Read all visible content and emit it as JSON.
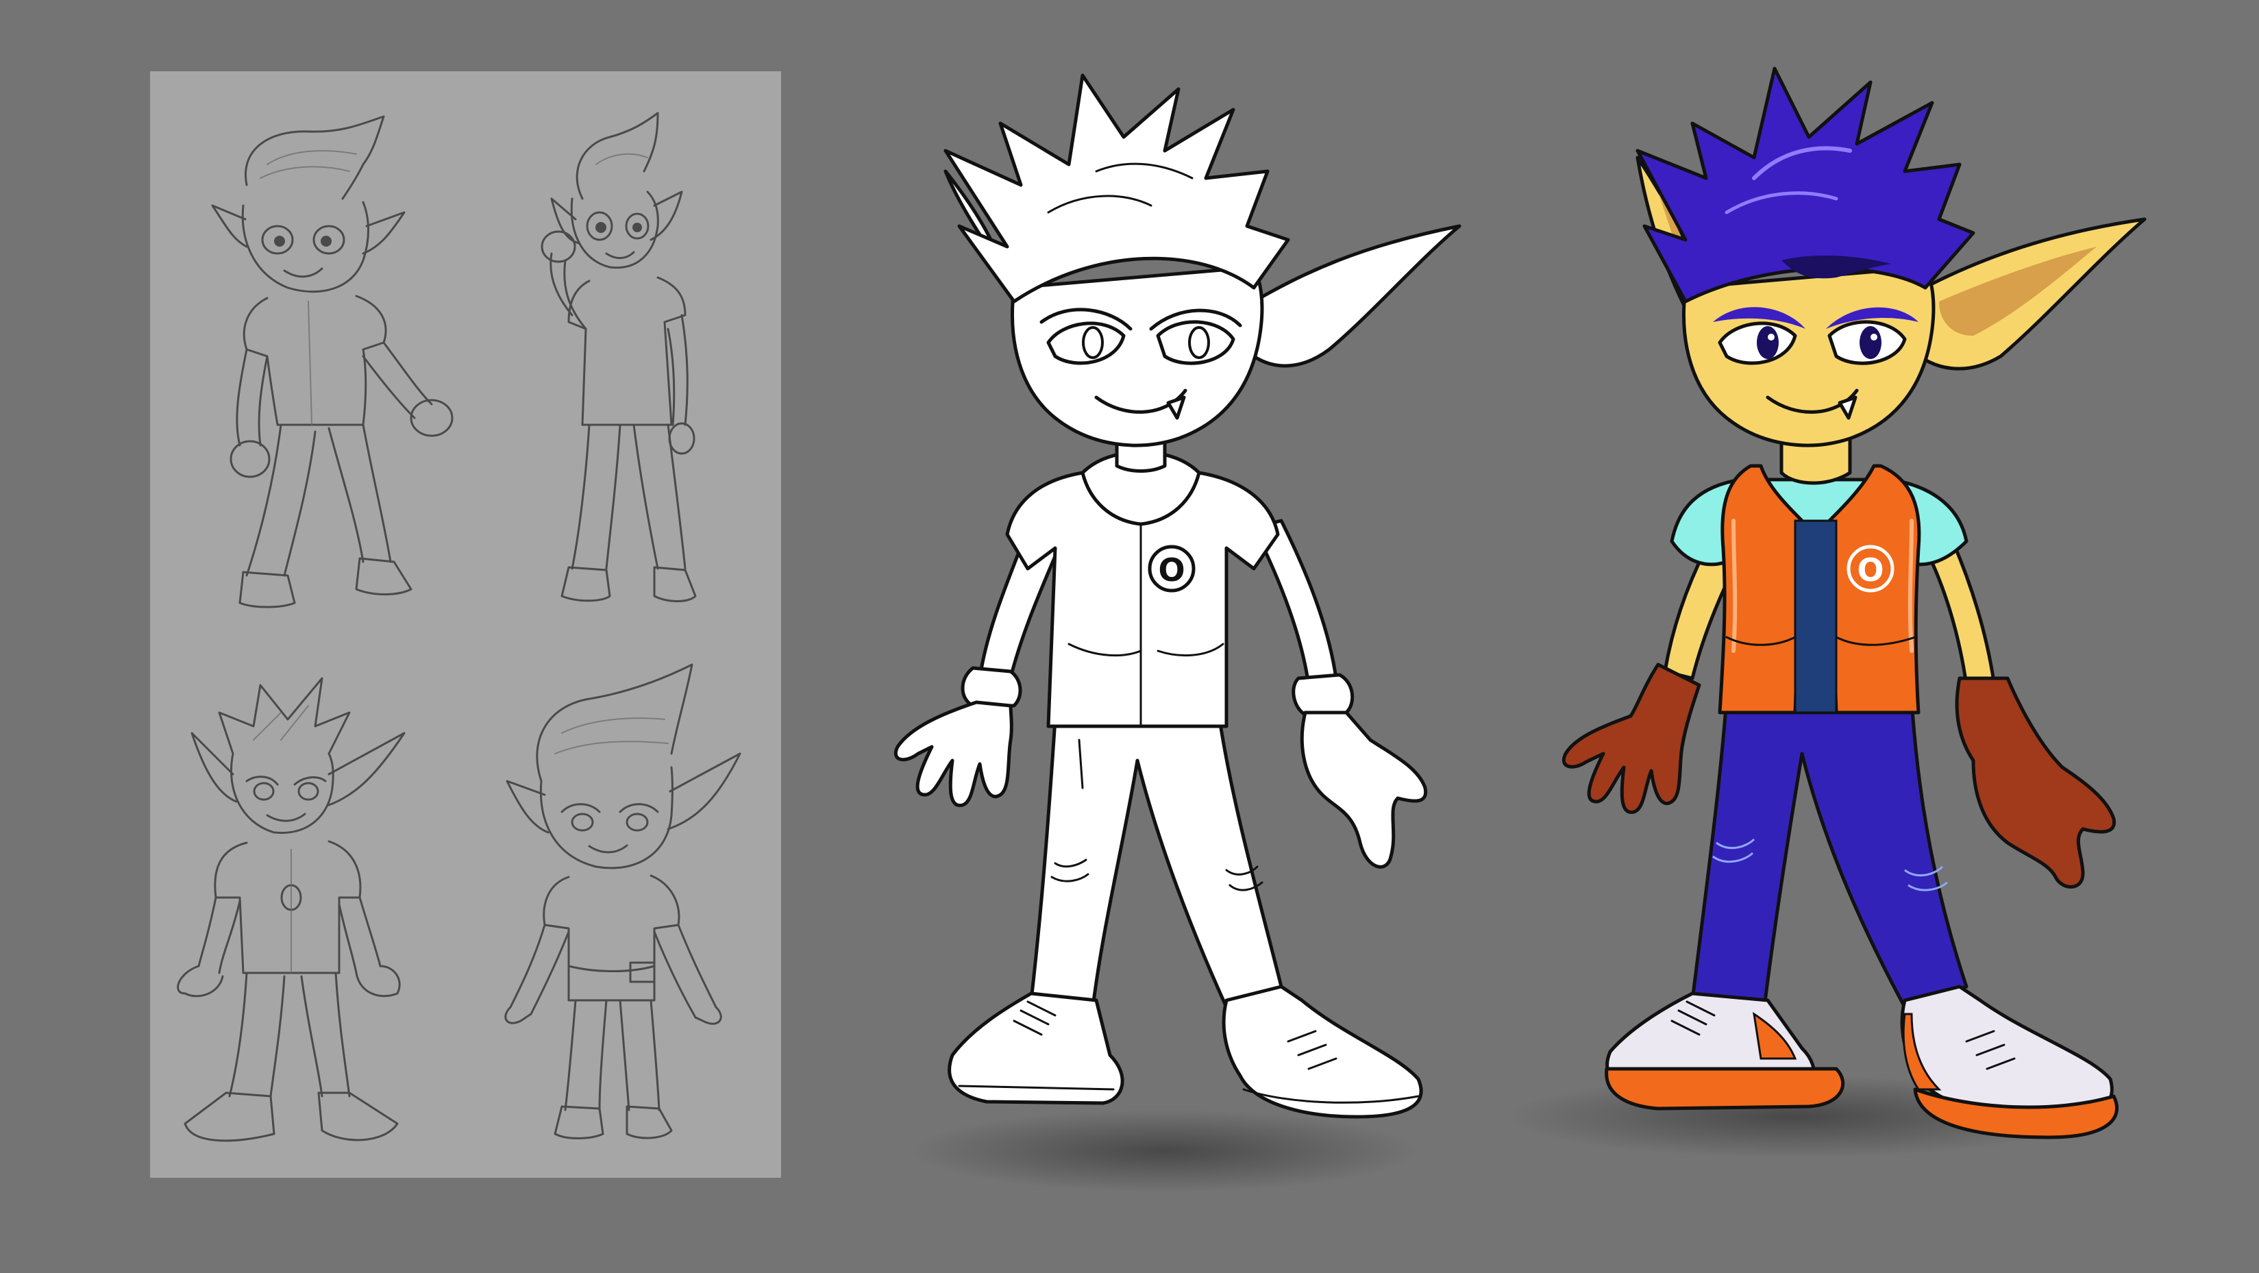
{
  "canvas": {
    "background_color": "#747474"
  },
  "sketch_panel": {
    "background_color": "#a6a6a6",
    "line_color": "#4a4a4a",
    "sketches": [
      {
        "pose": "standing-fists",
        "position": "top-left"
      },
      {
        "pose": "raised-fist",
        "position": "top-right"
      },
      {
        "pose": "jacket-standing",
        "position": "bottom-left"
      },
      {
        "pose": "chibi-standing",
        "position": "bottom-right"
      }
    ]
  },
  "lineart_figure": {
    "line_color": "#111111",
    "fill_color": "#ffffff",
    "jacket_emblem": "O"
  },
  "color_figure": {
    "hair_color": "#3b1fc2",
    "skin_color": "#f7d56b",
    "vest_color": "#f26a1b",
    "shirt_color": "#8ff0e8",
    "jeans_color": "#3322b8",
    "gloves_color": "#a03a1a",
    "shoes_color": "#ece8f2",
    "shoe_sole_color": "#f26a1b",
    "jacket_emblem": "O"
  }
}
